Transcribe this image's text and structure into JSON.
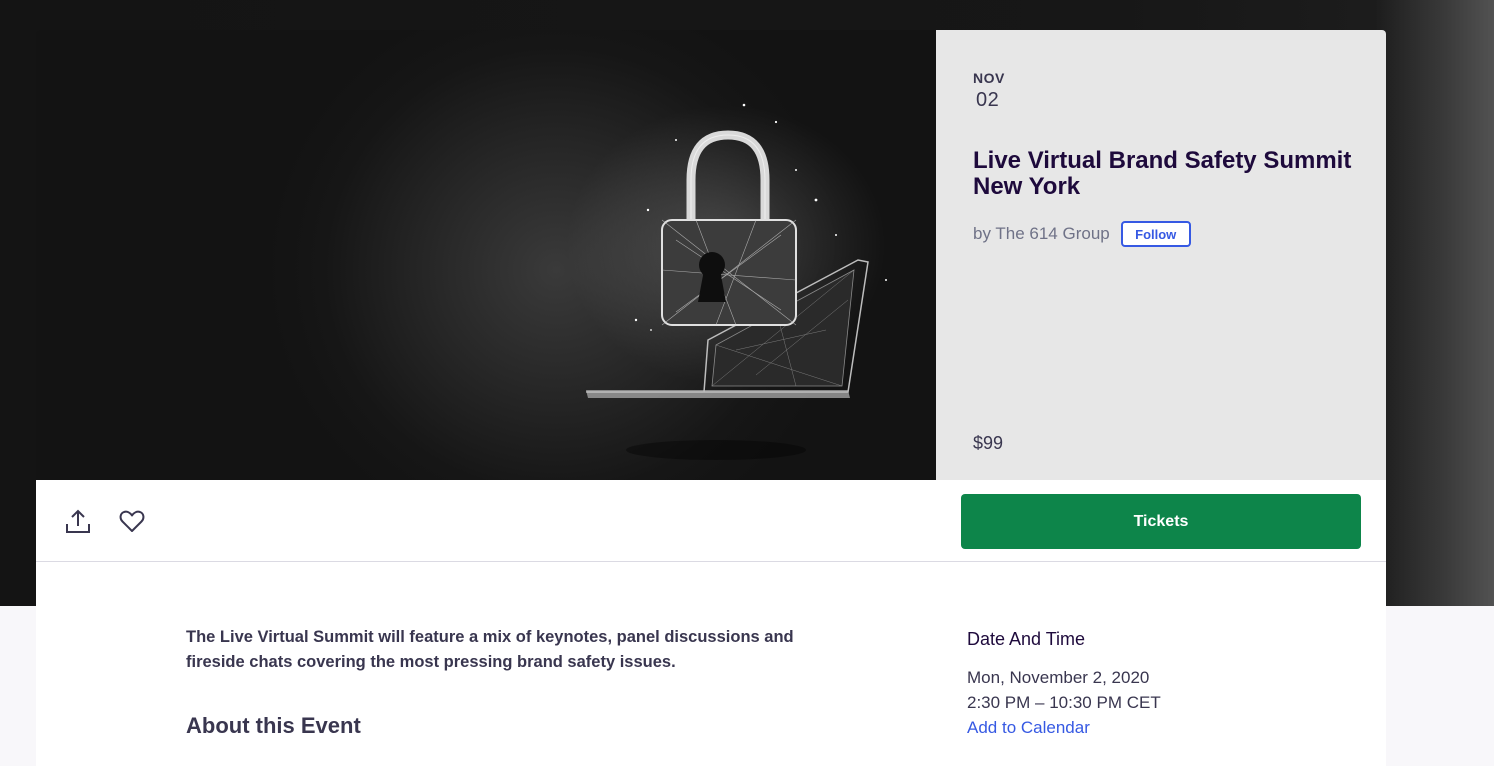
{
  "event": {
    "month": "NOV",
    "day": "02",
    "title": "Live Virtual Brand Safety Summit New York",
    "organizer": "by The 614 Group",
    "follow_label": "Follow",
    "price": "$99"
  },
  "actions": {
    "share_icon": "share-upload-icon",
    "like_icon": "heart-icon",
    "tickets_label": "Tickets",
    "tickets_color": "#0d854a"
  },
  "details": {
    "summary": "The Live Virtual Summit will feature a mix of keynotes, panel discussions and fireside chats covering the most pressing brand safety issues.",
    "about_heading": "About this Event",
    "date_time_heading": "Date And Time",
    "date": "Mon, November 2, 2020",
    "time": "2:30 PM – 10:30 PM CET",
    "add_to_calendar": "Add to Calendar"
  },
  "colors": {
    "accent_link": "#3659e3",
    "title_text": "#1e0a3c",
    "body_text": "#39364f",
    "muted_text": "#6f7287"
  }
}
